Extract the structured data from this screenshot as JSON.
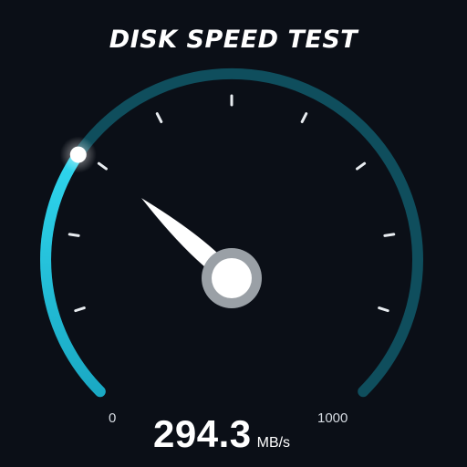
{
  "title": "DISK SPEED TEST",
  "gauge": {
    "min_label": "0",
    "max_label": "1000",
    "min": 0,
    "max": 1000,
    "value": 294.3,
    "value_label": "294.3",
    "unit": "MB/s",
    "tick_count": 10
  },
  "colors": {
    "background": "#0b0f17",
    "arc_track": "#0f4e5d",
    "arc_active": "#22c9e3",
    "needle": "#ffffff",
    "hub_ring": "#9aa0a6"
  }
}
